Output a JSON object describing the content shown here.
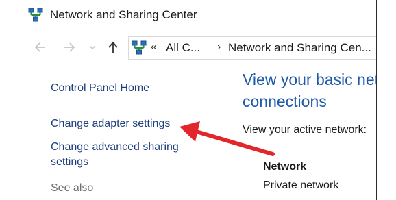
{
  "window": {
    "title": "Network and Sharing Center",
    "icon": "network-icon"
  },
  "navigation": {
    "back_icon": "back-arrow-icon",
    "forward_icon": "forward-arrow-icon",
    "recent_icon": "chevron-down-icon",
    "up_icon": "up-arrow-icon"
  },
  "address_bar": {
    "icon": "network-icon",
    "overflow": "«",
    "segments": [
      "All C...",
      "Network and Sharing Cen..."
    ],
    "separator": "›"
  },
  "sidebar": {
    "links": [
      {
        "label": "Control Panel Home"
      },
      {
        "label": "Change adapter settings"
      },
      {
        "label": "Change advanced sharing",
        "label_line2": "settings"
      }
    ],
    "see_also": "See also"
  },
  "main": {
    "heading_line1": "View your basic net",
    "heading_line2": "connections",
    "active_networks_label": "View your active network:",
    "network": {
      "name": "Network",
      "type": "Private network"
    }
  },
  "annotation": {
    "arrow_color": "#e3262b",
    "icon": "red-arrow-icon"
  },
  "colors": {
    "link": "#1e3e7f",
    "heading": "#1e5aa8",
    "muted": "#6d6d6d"
  }
}
